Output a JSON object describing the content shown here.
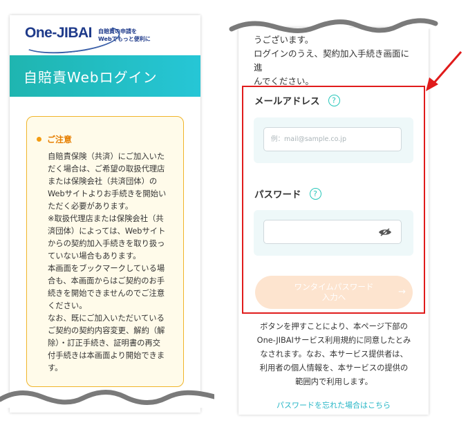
{
  "left": {
    "logo_text": "One-JIBAI",
    "logo_tagline": [
      "自賠責の申請を",
      "Webでもっと便利に"
    ],
    "title": "自賠責Webログイン",
    "notice": {
      "heading": "ご注意",
      "body": "自賠責保険（共済）にご加入いた\nだく場合は、ご希望の取扱代理店\nまたは保険会社（共済団体）の\nWebサイトよりお手続きを開始い\nただく必要があります。\n※取扱代理店または保険会社（共\n済団体）によっては、Webサイト\nからの契約加入手続きを取り扱っ\nていない場合もあります。\n本画面をブックマークしている場\n合も、本画面からはご契約のお手\n続きを開始できませんのでご注意\nください。\nなお、既にご加入いただいている\nご契約の契約内容変更、解約（解\n除）・訂正手続き、証明書の再交\n付手続きは本画面より開始できま\nす。"
    }
  },
  "right": {
    "intro": "うございます。\nログインのうえ、契約加入手続き画面に進\nんでください。",
    "email_label": "メールアドレス",
    "email_placeholder": "例：mail@sample.co.jp",
    "email_value": "",
    "password_label": "パスワード",
    "password_value": "",
    "help_glyph": "?",
    "otp_button_label": "ワンタイムパスワード\n入力へ",
    "otp_arrow": "→",
    "agreement": "ボタンを押すことにより、本ページ下部の\nOne-JIBAIサービス利用規約に同意したとみ\nなされます。なお、本サービス提供者は、\n利用者の個人情報を、本サービスの提供の\n範囲内で利用します。",
    "forgot_link": "パスワードを忘れた場合はこちら"
  },
  "icons": {
    "help": "question-circle-icon",
    "eye": "eye-slash-icon",
    "arrow": "arrow-right-icon",
    "pointer": "red-pointer-arrow-icon"
  },
  "colors": {
    "teal": "#26c6d6",
    "notice_border": "#f0b429",
    "notice_heading": "#e67e00",
    "highlight_border": "#e01b1b",
    "button_disabled": "#fde4cf",
    "logo": "#1e3a8a"
  }
}
